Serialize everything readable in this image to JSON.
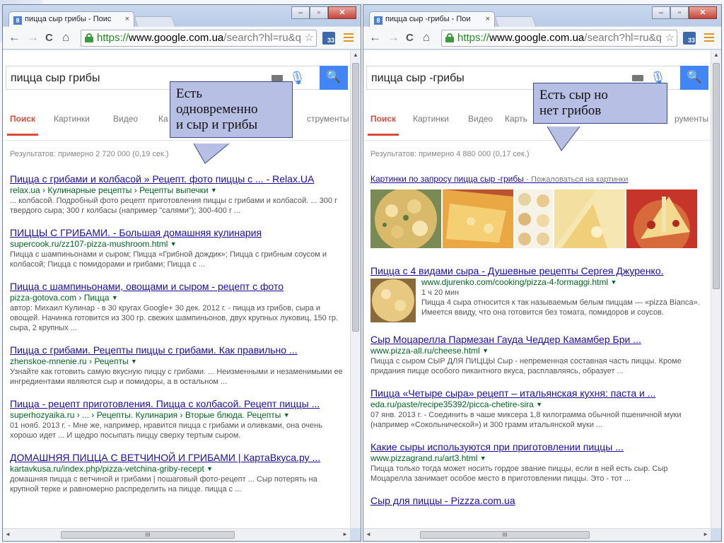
{
  "browser": {
    "window_controls": {
      "minimize": "–",
      "maximize": "▫",
      "close": "✕"
    },
    "tab_close": "×",
    "favicon": "8",
    "back": "←",
    "forward": "→",
    "reload": "C",
    "home": "⌂",
    "url_scheme": "https://",
    "url_host": "www.google.com.ua",
    "url_rest": "/search?hl=ru&q",
    "star_icon": "☆",
    "ext_badge": "33",
    "scroll_thumb_grip": "III"
  },
  "left": {
    "tab_title": "пицца сыр грибы - Поис",
    "query": "пицца сыр грибы",
    "tabs": [
      "Поиск",
      "Картинки",
      "Видео",
      "Ка",
      "струменты"
    ],
    "stats": "Результатов: примерно 2 720 000 (0,19 сек.)",
    "callout": [
      "Есть",
      "одновременно",
      "и сыр и грибы"
    ],
    "results": [
      {
        "title": "Пицца с грибами и колбасой » Рецепт. фото пиццы с ... - Relax.UA",
        "url": "relax.ua › Кулинарные рецепты › Рецепты выпечки",
        "snippet": "... колбасой. Подробный фото рецепт приготовления пиццы с грибами и колбасой. ... 300 г твердого сыра; 300 г колбасы (например \"салями\"); 300-400 г ..."
      },
      {
        "title": "ПИЦЦЫ С ГРИБАМИ. - Большая домашняя кулинария",
        "url": "supercook.ru/zz107-pizza-mushroom.html",
        "snippet": "Пицца с шампиньонами и сыром; Пицца «Грибной дождик»; Пицца с грибным соусом и колбасой; Пицца с помидорами и грибами; Пицца с ..."
      },
      {
        "title": "Пицца с шампиньонами, овощами и сыром - рецепт с фото",
        "url": "pizza-gotova.com › Пицца",
        "snippet": "автор: Михаил Кулинар - в 30 кругах Google+ 30 дек. 2012 г. - пицца из грибов, сыра и овощей. Начинка готовится из 300 гр. свежих шампиньонов, двух крупных луковиц, 150 гр. сыра, 2 крупных ..."
      },
      {
        "title": "Пицца с грибами. Рецепты пиццы с грибами. Как правильно ...",
        "url": "zhenskoe-mnenie.ru › Рецепты",
        "snippet": "Узнайте как готовить самую вкусную пиццу с грибами. ... Неизменными и незаменимыми ее ингредиентами являются сыр и помидоры, а в остальном ..."
      },
      {
        "title": "Пицца - рецепт приготовления. Пицца с колбасой. Рецепт пиццы ...",
        "url": "superhozyaika.ru › ... › Рецепты. Кулинария › Вторые блюда. Рецепты",
        "snippet": "01 нояб. 2013 г. - Мне же, например, нравится пицца с грибами и оливками, она очень хорошо идет ... И щедро посыпать пиццу сверху тертым сыром."
      },
      {
        "title": "ДОМАШНЯЯ ПИЦЦА С ВЕТЧИНОЙ И ГРИБАМИ | КартаВкуса.ру ...",
        "url": "kartavkusa.ru/index.php/pizza-vetchina-griby-recept",
        "snippet": "домашняя пицца с ветчиной и грибами | пошаговый фото-рецепт ... Сыр потерять на крупной терке и равномерно распределить на пицце. пицца с ..."
      }
    ]
  },
  "right": {
    "tab_title": "пицца сыр -грибы - Пои",
    "query": "пицца сыр -грибы",
    "tabs": [
      "Поиск",
      "Картинки",
      "Видео",
      "Карть",
      "рументы"
    ],
    "stats": "Результатов: примерно 4 880 000 (0,17 сек.)",
    "callout": [
      "Есть сыр но",
      "нет грибов"
    ],
    "images_link": "Картинки по запросу пицца сыр -грибы",
    "images_report": "- Пожаловаться на картинки",
    "results": [
      {
        "title": "Пицца с 4 видами сыра - Душевные рецепты Сергея Джуренко.",
        "url": "www.djurenko.com/cooking/pizza-4-formaggi.html",
        "meta": "1 ч 20 мин",
        "snippet": "Пицца 4 сыра относится к так называемым белым пиццам — «pizza Bianca». Имеется ввиду, что она готовится без томата, помидоров и соусов."
      },
      {
        "title": "Сыр Моцарелла Пармезан Гауда Чеддер Камамбер Бри ...",
        "url": "www.pizza-all.ru/cheese.html",
        "snippet": "Пицца с сыром СЫР ДЛЯ ПИЦЦЫ Сыр - непременная составная часть пиццы. Кроме придания пицце особого пикантного вкуса, расплавляясь, образует ..."
      },
      {
        "title": "Пицца «Четыре сыра» рецепт – итальянская кухня: паста и ...",
        "url": "eda.ru/paste/recipe35392/picca-chetire-sira",
        "snippet": "07 янв. 2013 г. - Соединить в чаше миксера 1,8 килограмма обычной пшеничной муки (например «Сокольнической») и 300 грамм итальянской муки ..."
      },
      {
        "title": "Какие сыры используются при приготовлении пиццы ...",
        "url": "www.pizzagrand.ru/art3.html",
        "snippet": "Пицца только тогда может носить гордое звание пиццы, если в ней есть сыр. Сыр Моцарелла занимает особое место в приготовлении пиццы. Это - тот ..."
      },
      {
        "title": "Сыр для пиццы - Pizzza.com.ua",
        "url": "",
        "snippet": ""
      }
    ]
  }
}
